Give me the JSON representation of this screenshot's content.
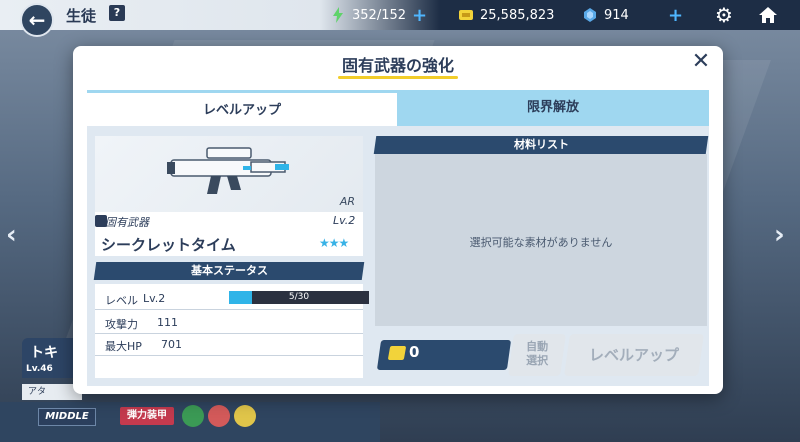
{
  "topbar": {
    "title": "生徒",
    "help_label": "?",
    "ap": "352/152",
    "credits": "25,585,823",
    "gems": "914",
    "plus": "+"
  },
  "nav": {
    "left_arrow": "‹",
    "right_arrow": "›",
    "back": "←"
  },
  "character": {
    "name": "トキ",
    "level": "Lv.46",
    "row_label": "アタ",
    "role": "MIDDLE",
    "armor": "弾力装甲"
  },
  "modal": {
    "title": "固有武器の強化",
    "close": "✕",
    "tabs": [
      {
        "label": "レベルアップ",
        "active": true
      },
      {
        "label": "限界解放",
        "active": false
      }
    ],
    "weapon": {
      "class": "AR",
      "type_label": "固有武器",
      "level": "Lv.2",
      "name": "シークレットタイム",
      "stars": "★★★"
    },
    "stats_header": "基本ステータス",
    "stats": [
      {
        "label": "レベル",
        "value": "Lv.2"
      },
      {
        "label": "攻撃力",
        "value": "111"
      },
      {
        "label": "最大HP",
        "value": "701"
      }
    ],
    "exp": {
      "text": "5/30",
      "fraction": 0.1667
    },
    "materials_header": "材料リスト",
    "materials_empty": "選択可能な素材がありません",
    "cost": "0",
    "auto_select": "自動選択",
    "levelup_button": "レベルアップ"
  },
  "colors": {
    "accent": "#2fb4e8",
    "header": "#2b4a6e",
    "tab_active_bar": "#9fd7f0",
    "title_underline": "#f2cd2a"
  }
}
